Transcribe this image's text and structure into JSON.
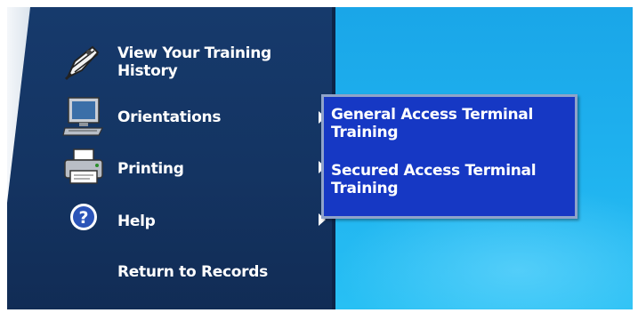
{
  "menu": {
    "items": [
      {
        "label": "View Your Training History",
        "icon": "quill-pen-icon",
        "has_submenu": false
      },
      {
        "label": "Orientations",
        "icon": "computer-icon",
        "has_submenu": true
      },
      {
        "label": "Printing",
        "icon": "printer-icon",
        "has_submenu": true
      },
      {
        "label": "Help",
        "icon": "help-icon",
        "has_submenu": true
      },
      {
        "label": "Return to Records",
        "icon": "",
        "has_submenu": false
      }
    ]
  },
  "submenu": {
    "items": [
      {
        "label": "General Access Terminal Training"
      },
      {
        "label": "Secured Access Terminal Training"
      }
    ]
  },
  "colors": {
    "sidebar": "#143462",
    "background": "#1eb0ee",
    "submenu": "#1638c4",
    "submenu_border": "#8fa3c9",
    "text": "#ffffff"
  }
}
